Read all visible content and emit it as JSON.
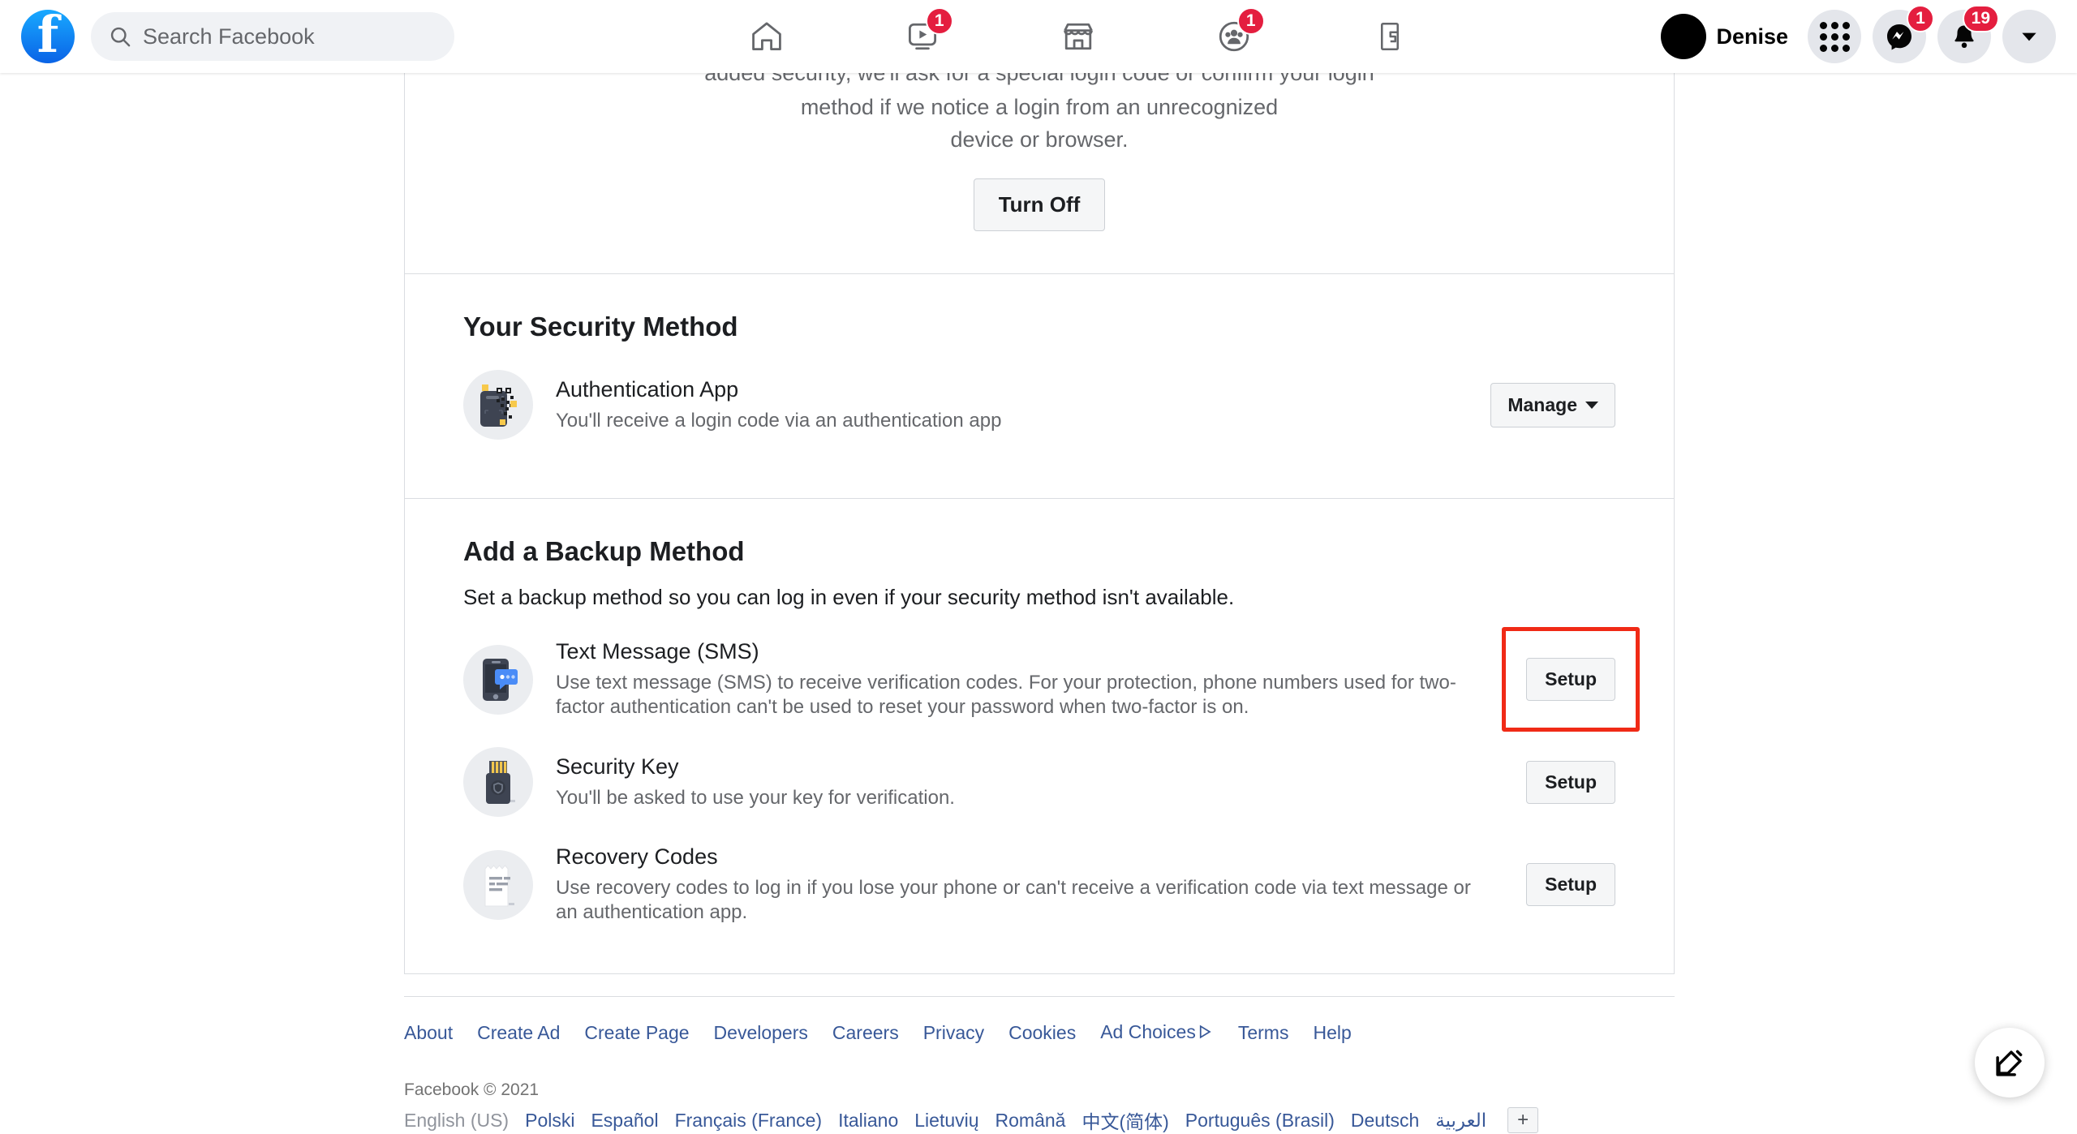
{
  "header": {
    "logo_alt": "Facebook",
    "search": {
      "placeholder": "Search Facebook",
      "value": ""
    },
    "nav": [
      {
        "name": "home",
        "icon": "home-icon",
        "badge": ""
      },
      {
        "name": "watch",
        "icon": "video-icon",
        "badge": "1"
      },
      {
        "name": "marketplace",
        "icon": "store-icon",
        "badge": ""
      },
      {
        "name": "groups",
        "icon": "groups-icon",
        "badge": "1"
      },
      {
        "name": "gaming",
        "icon": "gaming-icon",
        "badge": ""
      }
    ],
    "profile_name": "Denise",
    "menu_badge": "1",
    "notifications_badge": "19"
  },
  "intro": {
    "line_cut": "added security, we'll ask for a special login code or confirm your login",
    "line1": "method if we notice a login from an unrecognized",
    "line2": "device or browser.",
    "turn_off_label": "Turn Off"
  },
  "security_method": {
    "title": "Your Security Method",
    "row": {
      "icon": "authentication-app-icon",
      "title": "Authentication App",
      "desc": "You'll receive a login code via an authentication app",
      "action_label": "Manage"
    }
  },
  "backup_method": {
    "title": "Add a Backup Method",
    "subtitle": "Set a backup method so you can log in even if your security method isn't available.",
    "rows": [
      {
        "icon": "sms-phone-icon",
        "title": "Text Message (SMS)",
        "desc": "Use text message (SMS) to receive verification codes. For your protection, phone numbers used for two-factor authentication can't be used to reset your password when two-factor is on.",
        "action_label": "Setup",
        "highlighted": true
      },
      {
        "icon": "security-key-icon",
        "title": "Security Key",
        "desc": "You'll be asked to use your key for verification.",
        "action_label": "Setup",
        "highlighted": false
      },
      {
        "icon": "recovery-codes-icon",
        "title": "Recovery Codes",
        "desc": "Use recovery codes to log in if you lose your phone or can't receive a verification code via text message or an authentication app.",
        "action_label": "Setup",
        "highlighted": false
      }
    ]
  },
  "footer": {
    "links": [
      "About",
      "Create Ad",
      "Create Page",
      "Developers",
      "Careers",
      "Privacy",
      "Cookies",
      "Ad Choices",
      "Terms",
      "Help"
    ],
    "ad_choices_index": 7,
    "copyright": "Facebook © 2021",
    "languages": [
      "English (US)",
      "Polski",
      "Español",
      "Français (France)",
      "Italiano",
      "Lietuvių",
      "Română",
      "中文(简体)",
      "Português (Brasil)",
      "Deutsch",
      "العربية"
    ],
    "current_language_index": 0,
    "more_languages_label": "+"
  },
  "fab": {
    "icon": "compose-icon"
  },
  "colors": {
    "accent": "#1877F2",
    "badge_red": "#E41E3F",
    "highlight_red": "#F02A16",
    "link_blue": "#385898",
    "border": "#DADDE1"
  }
}
